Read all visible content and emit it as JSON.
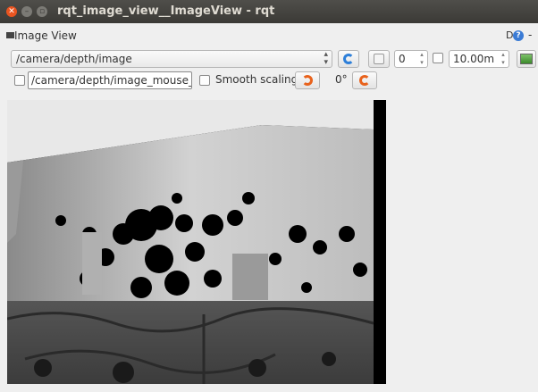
{
  "window": {
    "title": "rqt_image_view__ImageView - rqt"
  },
  "dock": {
    "title": "Image View",
    "d_label": "D",
    "help_label": "?",
    "close_label": "-"
  },
  "toolbar": {
    "topic": "/camera/depth/image",
    "zoom_value": "0",
    "max_range": "10.00m"
  },
  "row2": {
    "mouse_topic": "/camera/depth/image_mouse_left",
    "smooth_scaling_label": "Smooth scaling",
    "rotation": "0°"
  },
  "icons": {
    "refresh": "refresh-icon",
    "save": "save-icon",
    "screenshot": "image-icon",
    "rotate_left": "rotate-left-icon",
    "rotate_right": "rotate-right-icon"
  }
}
